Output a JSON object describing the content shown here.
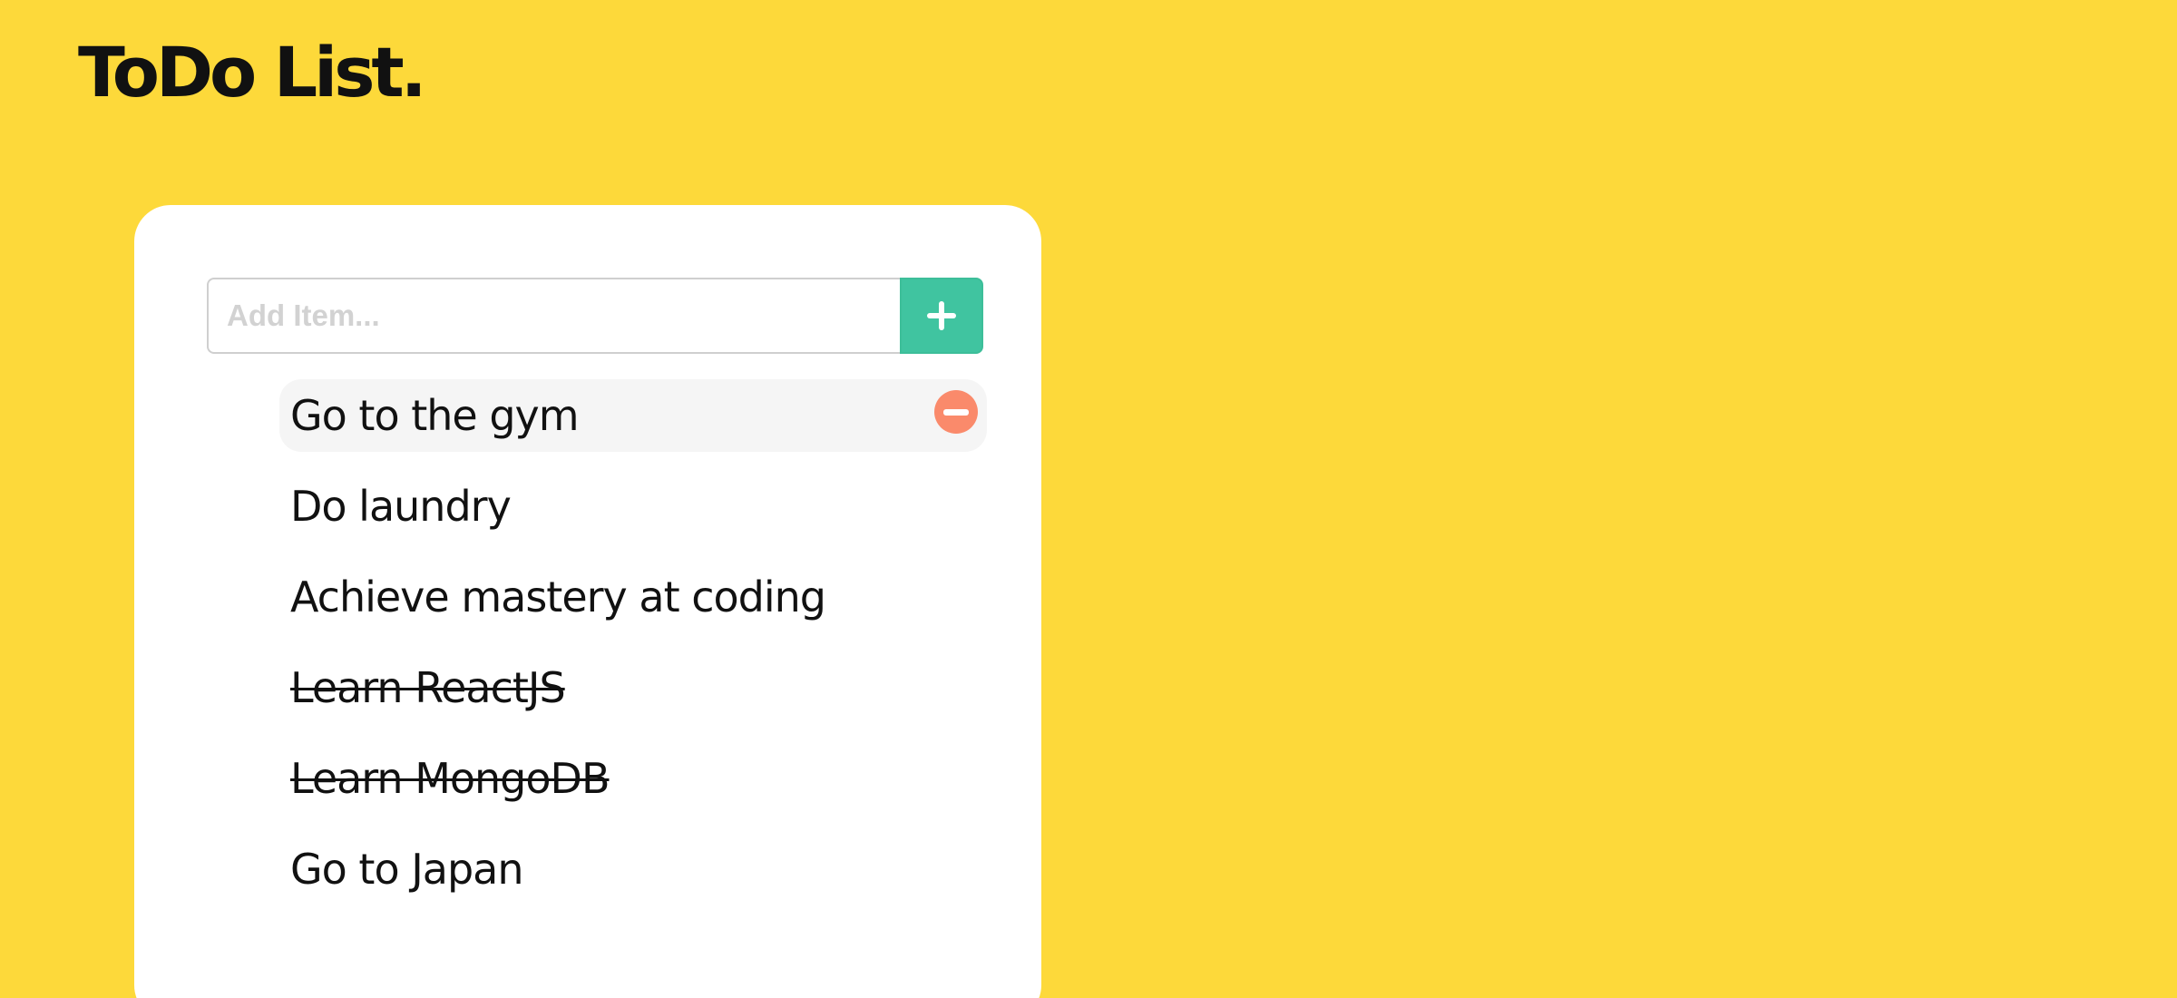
{
  "header": {
    "title": "ToDo List."
  },
  "add_form": {
    "placeholder": "Add Item...",
    "value": "",
    "button_icon": "plus-icon"
  },
  "todos": [
    {
      "text": "Go to the gym",
      "done": false,
      "hovered": true,
      "action_icon": "minus-circle-icon"
    },
    {
      "text": "Do laundry",
      "done": false
    },
    {
      "text": "Achieve mastery at coding",
      "done": false
    },
    {
      "text": "Learn ReactJS",
      "done": true
    },
    {
      "text": "Learn MongoDB",
      "done": true
    },
    {
      "text": "Go to Japan",
      "done": false
    }
  ],
  "colors": {
    "background": "#FDD93A",
    "card": "#FFFFFF",
    "add_button": "#40C4A0",
    "delete_button": "#FA8A6B",
    "hover_row": "#F5F5F5",
    "text": "#111111"
  }
}
